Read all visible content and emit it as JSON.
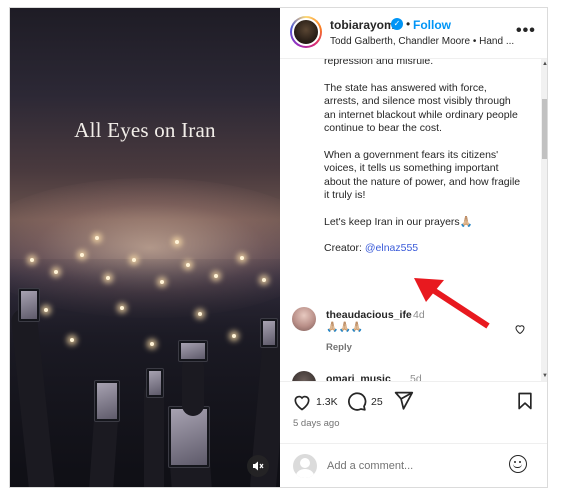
{
  "media": {
    "title": "All Eyes on Iran",
    "mute_icon": "speaker-muted-icon"
  },
  "header": {
    "username": "tobiarayomi",
    "verified_icon": "verified-check-icon",
    "separator": "•",
    "follow_label": "Follow",
    "subline": "Todd Galberth, Chandler Moore • Hand ...",
    "more_icon": "more-options-icon",
    "more_label": "•••"
  },
  "caption": {
    "paragraphs": [
      "repression and misrule.",
      "The state has answered with force, arrests, and silence most visibly through an internet blackout while ordinary people continue to bear the cost.",
      "When a government fears its citizens' voices, it tells us something important about the nature of power, and how fragile it truly is!",
      "Let's keep Iran in our prayers🙏🏼"
    ],
    "creator_prefix": "Creator: ",
    "creator_handle": "@elnaz555"
  },
  "comments": [
    {
      "username": "theaudacious_ife",
      "time": "4d",
      "text": "🙏🏼🙏🏼🙏🏼",
      "reply_label": "Reply"
    },
    {
      "username": "omari_music",
      "time": "5d"
    }
  ],
  "actions": {
    "like_count": "1.3K",
    "comment_count": "25",
    "posted": "5 days ago"
  },
  "add_comment": {
    "placeholder": "Add a comment..."
  },
  "colors": {
    "accent": "#0095f6",
    "annotation_arrow": "#e8191f"
  }
}
